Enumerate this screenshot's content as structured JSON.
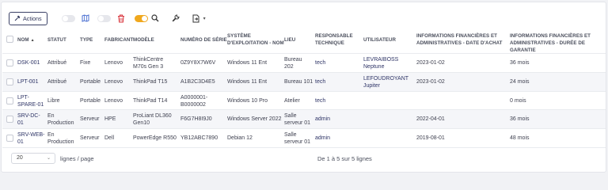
{
  "toolbar": {
    "actions_label": "Actions",
    "icons": [
      "actions-icon",
      "toggle-1",
      "map-icon",
      "toggle-2",
      "trash-icon",
      "toggle-3",
      "search-icon",
      "wrench-icon",
      "export-icon"
    ]
  },
  "table": {
    "columns": [
      [
        "NOM"
      ],
      [
        "STATUT"
      ],
      [
        "TYPE"
      ],
      [
        "FABRICANT"
      ],
      [
        "MODÈLE"
      ],
      [
        "NUMÉRO DE SÉRIE"
      ],
      [
        "SYSTÈME",
        "D'EXPLOITATION - NOM"
      ],
      [
        "LIEU"
      ],
      [
        "RESPONSABLE",
        "TECHNIQUE"
      ],
      [
        "UTILISATEUR"
      ],
      [
        "INFORMATIONS FINANCIÈRES ET",
        "ADMINISTRATIVES - DATE D'ACHAT"
      ],
      [
        "INFORMATIONS FINANCIÈRES ET",
        "ADMINISTRATIVES - DURÉE DE GARANTIE"
      ]
    ],
    "rows": [
      {
        "nom": [
          "DSK-001"
        ],
        "statut": [
          "Attribué"
        ],
        "type": [
          "Fixe"
        ],
        "fabricant": [
          "Lenovo"
        ],
        "modele": [
          "ThinkCentre",
          "M70s Gen 3"
        ],
        "serie": [
          "0Z9Y8X7W6V"
        ],
        "os": [
          "Windows 11 Ent"
        ],
        "lieu": [
          "Bureau",
          "202"
        ],
        "responsable": [
          "tech"
        ],
        "utilisateur": [
          "LEVRAIBOSS",
          "Neptune"
        ],
        "date_achat": [
          "2023-01-02"
        ],
        "garantie": [
          "36 mois"
        ]
      },
      {
        "nom": [
          "LPT-001"
        ],
        "statut": [
          "Attribué"
        ],
        "type": [
          "Portable"
        ],
        "fabricant": [
          "Lenovo"
        ],
        "modele": [
          "ThinkPad T15"
        ],
        "serie": [
          "A1B2C3D4E5"
        ],
        "os": [
          "Windows 11 Ent"
        ],
        "lieu": [
          "Bureau 101"
        ],
        "responsable": [
          "tech"
        ],
        "utilisateur": [
          "LEFOUDROYANT",
          "Jupiter"
        ],
        "date_achat": [
          "2023-01-02"
        ],
        "garantie": [
          "24 mois"
        ]
      },
      {
        "nom": [
          "LPT-",
          "SPARE-01"
        ],
        "statut": [
          "Libre"
        ],
        "type": [
          "Portable"
        ],
        "fabricant": [
          "Lenovo"
        ],
        "modele": [
          "ThinkPad T14"
        ],
        "serie": [
          "A0000001-",
          "B0000002"
        ],
        "os": [
          "Windows 10 Pro"
        ],
        "lieu": [
          "Atelier"
        ],
        "responsable": [
          "tech"
        ],
        "utilisateur": [
          ""
        ],
        "date_achat": [
          ""
        ],
        "garantie": [
          "0 mois"
        ]
      },
      {
        "nom": [
          "SRV-DC-",
          "01"
        ],
        "statut": [
          "En",
          "Production"
        ],
        "type": [
          "Serveur"
        ],
        "fabricant": [
          "HPE"
        ],
        "modele": [
          "ProLiant DL360",
          "Gen10"
        ],
        "serie": [
          "F6G7H8I9J0"
        ],
        "os": [
          "Windows Server 2022"
        ],
        "lieu": [
          "Salle",
          "serveur 01"
        ],
        "responsable": [
          "admin"
        ],
        "utilisateur": [
          ""
        ],
        "date_achat": [
          "2022-04-01"
        ],
        "garantie": [
          "36 mois"
        ]
      },
      {
        "nom": [
          "SRV-WEB-",
          "01"
        ],
        "statut": [
          "En",
          "Production"
        ],
        "type": [
          "Serveur"
        ],
        "fabricant": [
          "Dell"
        ],
        "modele": [
          "PowerEdge R550"
        ],
        "serie": [
          "YB12ABC7890"
        ],
        "os": [
          "Debian 12"
        ],
        "lieu": [
          "Salle",
          "serveur 01"
        ],
        "responsable": [
          "admin"
        ],
        "utilisateur": [
          ""
        ],
        "date_achat": [
          "2019-08-01"
        ],
        "garantie": [
          "48 mois"
        ]
      }
    ]
  },
  "footer": {
    "page_size": "20",
    "lines_label": "lignes / page",
    "pagination_text": "De 1 à 5 sur 5 lignes"
  },
  "colors": {
    "link": "#2e3466",
    "accent_toggle": "#f0a81e",
    "trash": "#d9363e",
    "map": "#4a6fd1"
  }
}
